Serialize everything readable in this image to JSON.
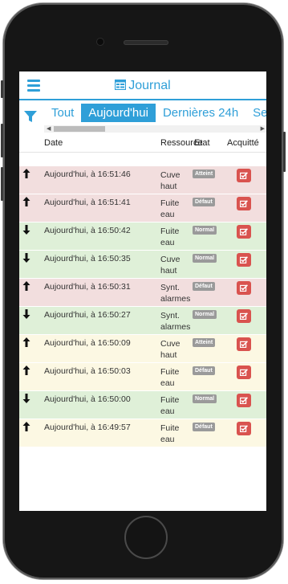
{
  "header": {
    "title": "Journal"
  },
  "tabs": [
    {
      "label": "Tout",
      "active": false
    },
    {
      "label": "Aujourd'hui",
      "active": true
    },
    {
      "label": "Dernières 24h",
      "active": false
    },
    {
      "label": "Se",
      "active": false
    }
  ],
  "table": {
    "columns": {
      "date": "Date",
      "resource": "Ressource",
      "state": "Etat",
      "ack": "Acquitté"
    },
    "rows": [
      {
        "direction": "up",
        "color": "red",
        "date": "Aujourd'hui, à 16:51:46",
        "resource": [
          "Cuve",
          "haut"
        ],
        "state": "Atteint"
      },
      {
        "direction": "up",
        "color": "red",
        "date": "Aujourd'hui, à 16:51:41",
        "resource": [
          "Fuite",
          "eau"
        ],
        "state": "Défaut"
      },
      {
        "direction": "down",
        "color": "green",
        "date": "Aujourd'hui, à 16:50:42",
        "resource": [
          "Fuite",
          "eau"
        ],
        "state": "Normal"
      },
      {
        "direction": "down",
        "color": "green",
        "date": "Aujourd'hui, à 16:50:35",
        "resource": [
          "Cuve",
          "haut"
        ],
        "state": "Normal"
      },
      {
        "direction": "up",
        "color": "red",
        "date": "Aujourd'hui, à 16:50:31",
        "resource": [
          "Synt.",
          "alarmes"
        ],
        "state": "Défaut"
      },
      {
        "direction": "down",
        "color": "green",
        "date": "Aujourd'hui, à 16:50:27",
        "resource": [
          "Synt.",
          "alarmes"
        ],
        "state": "Normal"
      },
      {
        "direction": "up",
        "color": "yellow",
        "date": "Aujourd'hui, à 16:50:09",
        "resource": [
          "Cuve",
          "haut"
        ],
        "state": "Atteint"
      },
      {
        "direction": "up",
        "color": "yellow",
        "date": "Aujourd'hui, à 16:50:03",
        "resource": [
          "Fuite",
          "eau"
        ],
        "state": "Défaut"
      },
      {
        "direction": "down",
        "color": "green",
        "date": "Aujourd'hui, à 16:50:00",
        "resource": [
          "Fuite",
          "eau"
        ],
        "state": "Normal"
      },
      {
        "direction": "up",
        "color": "yellow",
        "date": "Aujourd'hui, à 16:49:57",
        "resource": [
          "Fuite",
          "eau"
        ],
        "state": "Défaut"
      }
    ]
  },
  "colors": {
    "accent": "#2f9fd8",
    "ack_button": "#d9534f",
    "badge": "#9a9a9a",
    "row_red": "#f2dede",
    "row_green": "#dff0d8",
    "row_yellow": "#fcf8e3"
  },
  "icons": {
    "menu": "hamburger-icon",
    "journal": "journal-icon",
    "filter": "filter-icon",
    "ack": "checkbox-edit-icon",
    "arrow_up": "arrow-up-icon",
    "arrow_down": "arrow-down-icon"
  }
}
